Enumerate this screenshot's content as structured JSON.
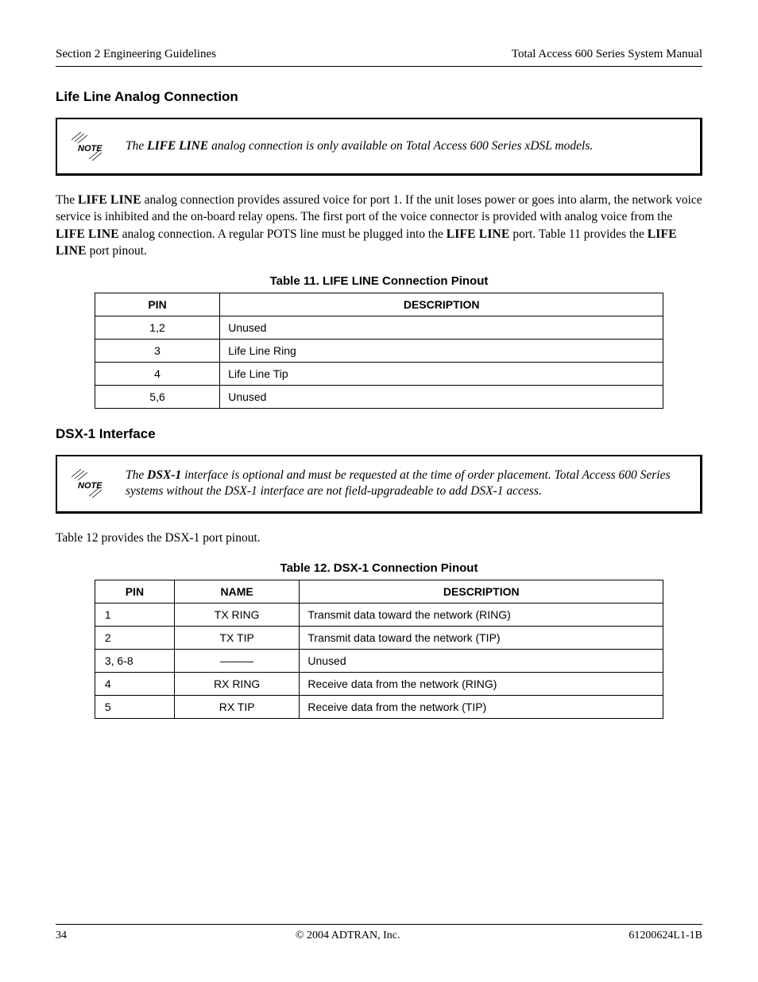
{
  "header": {
    "left": "Section 2  Engineering Guidelines",
    "right": "Total Access 600 Series System Manual"
  },
  "section1": {
    "heading": "Life Line Analog Connection",
    "note_pre": "The ",
    "note_b": "LIFE LINE",
    "note_post": " analog connection is only available on Total Access 600 Series xDSL models.",
    "para_1a": "The ",
    "para_1b": " analog connection provides assured voice for port 1. If the unit loses power or goes into alarm, the network voice service is inhibited and the on-board relay opens. The first port of the voice connector is provided with analog voice from the ",
    "para_1c": " analog connection. A regular POTS line must be plugged into the ",
    "para_1d": " port. Table 11 provides the ",
    "para_1e": " port pinout.",
    "sc": "LIFE LINE",
    "table_caption": "Table 11.  LIFE LINE Connection Pinout",
    "table_headers": {
      "pin": "PIN",
      "desc": "DESCRIPTION"
    },
    "rows": [
      {
        "pin": "1,2",
        "desc": "Unused"
      },
      {
        "pin": "3",
        "desc": "Life Line Ring"
      },
      {
        "pin": "4",
        "desc": "Life Line Tip"
      },
      {
        "pin": "5,6",
        "desc": "Unused"
      }
    ]
  },
  "section2": {
    "heading": "DSX-1 Interface",
    "note_pre": "The ",
    "note_b": "DSX-1",
    "note_post": " interface is optional and must be requested at the time of order placement. Total Access 600 Series systems without the DSX-1 interface are not field-upgradeable to add DSX-1 access.",
    "para": "Table 12 provides the DSX-1 port pinout.",
    "table_caption": "Table 12.  DSX-1 Connection Pinout",
    "table_headers": {
      "pin": "PIN",
      "name": "NAME",
      "desc": "DESCRIPTION"
    },
    "rows": [
      {
        "pin": "1",
        "name": "TX RING",
        "desc": "Transmit data toward the network (RING)"
      },
      {
        "pin": "2",
        "name": "TX TIP",
        "desc": "Transmit data toward the network (TIP)"
      },
      {
        "pin": "3, 6-8",
        "name": "———",
        "desc": "Unused"
      },
      {
        "pin": "4",
        "name": "RX RING",
        "desc": "Receive data from the network (RING)"
      },
      {
        "pin": "5",
        "name": "RX TIP",
        "desc": "Receive data from the network (TIP)"
      }
    ]
  },
  "footer": {
    "left": "34",
    "center": "© 2004 ADTRAN, Inc.",
    "right": "61200624L1-1B"
  }
}
